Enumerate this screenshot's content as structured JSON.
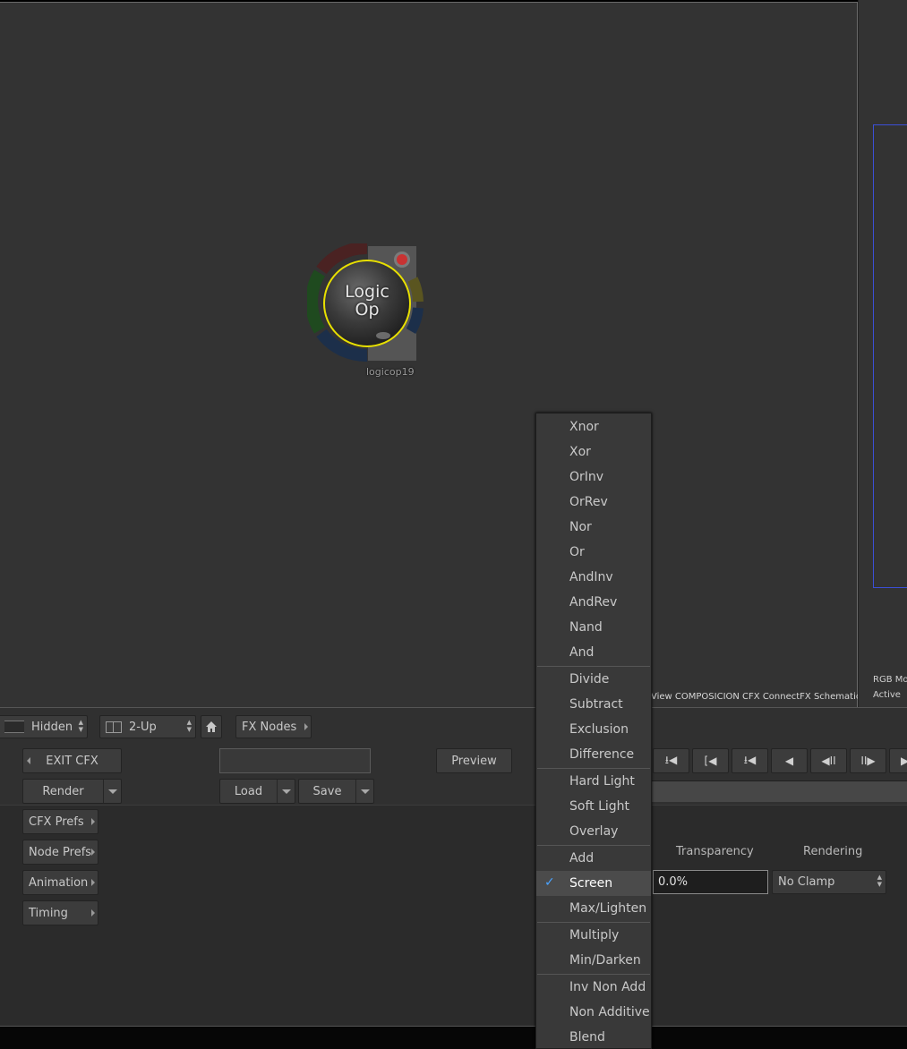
{
  "schematic": {
    "view_label": "View COMPOSICION CFX ConnectFX Schematic",
    "node": {
      "title_line1": "Logic",
      "title_line2": "Op",
      "name": "logicop19"
    }
  },
  "right_panel": {
    "mode_label": "RGB Mode",
    "status": "Active"
  },
  "toolbar": {
    "visibility": "Hidden",
    "layout": "2-Up",
    "home_icon": "home-icon",
    "fx_nodes": "FX Nodes"
  },
  "controls": {
    "exit_cfx": "EXIT CFX",
    "render": "Render",
    "name_field": "",
    "load": "Load",
    "save": "Save",
    "preview": "Preview",
    "cfx_prefs": "CFX Prefs",
    "node_prefs": "Node Prefs",
    "animation": "Animation",
    "timing": "Timing"
  },
  "transport": {
    "buttons": [
      "goto-start",
      "prev-key",
      "step-back-key",
      "play-reverse",
      "step-back",
      "step-forward",
      "play-forward"
    ]
  },
  "params": {
    "transparency_label": "Transparency",
    "transparency_value": "0.0%",
    "rendering_label": "Rendering",
    "rendering_value": "No Clamp"
  },
  "blend_menu": {
    "selected": "Screen",
    "items": [
      "Xnor",
      "Xor",
      "OrInv",
      "OrRev",
      "Nor",
      "Or",
      "AndInv",
      "AndRev",
      "Nand",
      "And",
      "Divide",
      "Subtract",
      "Exclusion",
      "Difference",
      "Hard Light",
      "Soft Light",
      "Overlay",
      "Add",
      "Screen",
      "Max/Lighten",
      "Multiply",
      "Min/Darken",
      "Inv Non Add",
      "Non Additive",
      "Blend"
    ]
  },
  "colors": {
    "background": "#333333",
    "accent_selection": "#e8e000",
    "check": "#4aa3ff",
    "viewer_frame": "#3b4fd8"
  }
}
